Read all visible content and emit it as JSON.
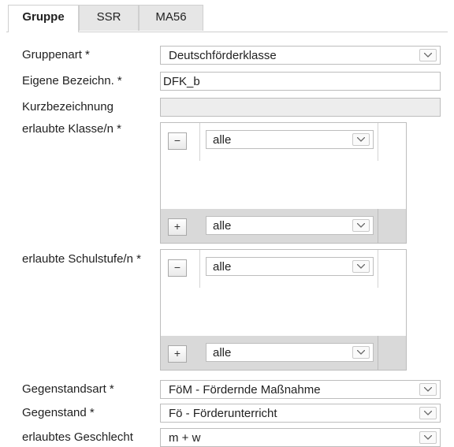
{
  "tabs": [
    {
      "label": "Gruppe",
      "active": true
    },
    {
      "label": "SSR",
      "active": false
    },
    {
      "label": "MA56",
      "active": false
    }
  ],
  "form": {
    "gruppenart": {
      "label": "Gruppenart *",
      "value": "Deutschförderklasse"
    },
    "eigene_bezeichnung": {
      "label": "Eigene Bezeichn. *",
      "value": "DFK_b"
    },
    "kurzbezeichnung": {
      "label": "Kurzbezeichnung",
      "value": ""
    },
    "erlaubte_klassen": {
      "label": "erlaubte Klasse/n *",
      "remove_button": "−",
      "selected": "alle",
      "add_button": "+",
      "add_select": "alle"
    },
    "erlaubte_schulstufen": {
      "label": "erlaubte Schulstufe/n *",
      "remove_button": "−",
      "selected": "alle",
      "add_button": "+",
      "add_select": "alle"
    },
    "gegenstandsart": {
      "label": "Gegenstandsart *",
      "value": "FöM - Fördernde Maßnahme"
    },
    "gegenstand": {
      "label": "Gegenstand *",
      "value": "Fö - Förderunterricht"
    },
    "erlaubtes_geschlecht": {
      "label": "erlaubtes Geschlecht",
      "value": "m + w"
    }
  },
  "icons": {
    "dropdown": "chevron-down-icon",
    "remove": "minus-icon",
    "add": "plus-icon"
  }
}
